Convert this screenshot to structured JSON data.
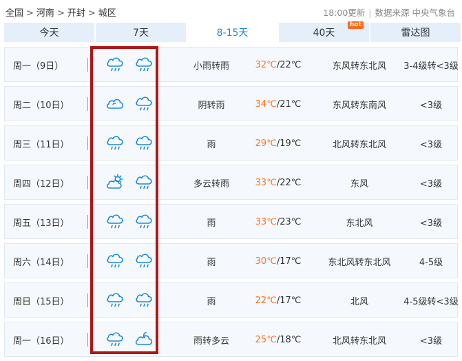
{
  "breadcrumb": [
    "全国",
    "河南",
    "开封",
    "城区"
  ],
  "breadcrumb_sep": ">",
  "meta": {
    "update": "18:00更新",
    "source": "数据来源 中央气象台"
  },
  "tabs": [
    {
      "label": "今天",
      "active": false
    },
    {
      "label": "7天",
      "active": false
    },
    {
      "label": "8-15天",
      "active": true
    },
    {
      "label": "40天",
      "active": false,
      "badge": "hot"
    },
    {
      "label": "雷达图",
      "active": false
    }
  ],
  "colors": {
    "accent": "#1c8ad8",
    "high_temp": "#ff7522",
    "highlight": "#b01616",
    "hot_badge": "#ff6a1a"
  },
  "forecast": [
    {
      "day": "周一（9日）",
      "icons": [
        "rain-cloud-icon",
        "rain-cloud-icon"
      ],
      "desc": "小雨转雨",
      "high": "32℃",
      "low": "/22℃",
      "wind": "东风转东北风",
      "level": "3-4级转<3级"
    },
    {
      "day": "周二（10日）",
      "icons": [
        "overcast-cloud-icon",
        "rain-cloud-icon"
      ],
      "desc": "阴转雨",
      "high": "34℃",
      "low": "/21℃",
      "wind": "东风转东南风",
      "level": "<3级"
    },
    {
      "day": "周三（11日）",
      "icons": [
        "rain-cloud-icon",
        "rain-cloud-icon"
      ],
      "desc": "雨",
      "high": "29℃",
      "low": "/19℃",
      "wind": "北风转东北风",
      "level": "<3级"
    },
    {
      "day": "周四（12日）",
      "icons": [
        "partly-cloudy-icon",
        "rain-cloud-icon"
      ],
      "desc": "多云转雨",
      "high": "33℃",
      "low": "/22℃",
      "wind": "东风",
      "level": "<3级"
    },
    {
      "day": "周五（13日）",
      "icons": [
        "rain-cloud-icon",
        "rain-cloud-icon"
      ],
      "desc": "雨",
      "high": "33℃",
      "low": "/23℃",
      "wind": "东北风",
      "level": "<3级"
    },
    {
      "day": "周六（14日）",
      "icons": [
        "rain-cloud-icon",
        "rain-cloud-icon"
      ],
      "desc": "雨",
      "high": "30℃",
      "low": "/17℃",
      "wind": "东北风转东北风",
      "level": "4-5级"
    },
    {
      "day": "周日（15日）",
      "icons": [
        "rain-cloud-icon",
        "rain-cloud-icon"
      ],
      "desc": "雨",
      "high": "22℃",
      "low": "/17℃",
      "wind": "北风",
      "level": "4-5级转<3级"
    },
    {
      "day": "周一（16日）",
      "icons": [
        "rain-cloud-icon",
        "partly-cloudy-night-icon"
      ],
      "desc": "雨转多云",
      "high": "25℃",
      "low": "/18℃",
      "wind": "北风转东北风",
      "level": "<3级"
    }
  ]
}
